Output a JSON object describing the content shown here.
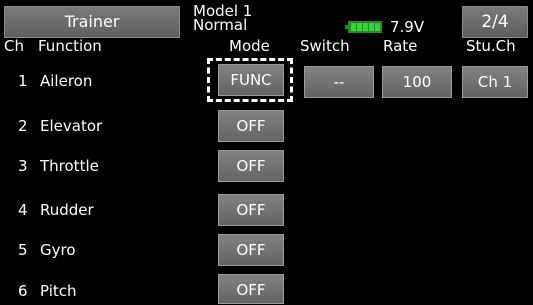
{
  "header": {
    "trainer_label": "Trainer",
    "model_name": "Model 1",
    "condition": "Normal",
    "battery_voltage": "7.9V",
    "page_indicator": "2/4"
  },
  "columns": {
    "ch": "Ch",
    "function": "Function",
    "mode": "Mode",
    "switch": "Switch",
    "rate": "Rate",
    "stu_ch": "Stu.Ch"
  },
  "rows": [
    {
      "ch": "1",
      "function": "Aileron",
      "mode": "FUNC",
      "switch": "--",
      "rate": "100",
      "stu_ch": "Ch 1"
    },
    {
      "ch": "2",
      "function": "Elevator",
      "mode": "OFF"
    },
    {
      "ch": "3",
      "function": "Throttle",
      "mode": "OFF"
    },
    {
      "ch": "4",
      "function": "Rudder",
      "mode": "OFF"
    },
    {
      "ch": "5",
      "function": "Gyro",
      "mode": "OFF"
    },
    {
      "ch": "6",
      "function": "Pitch",
      "mode": "OFF"
    }
  ],
  "colors": {
    "background": "#000000",
    "button": "#707070",
    "battery": "#3fcf3f"
  }
}
